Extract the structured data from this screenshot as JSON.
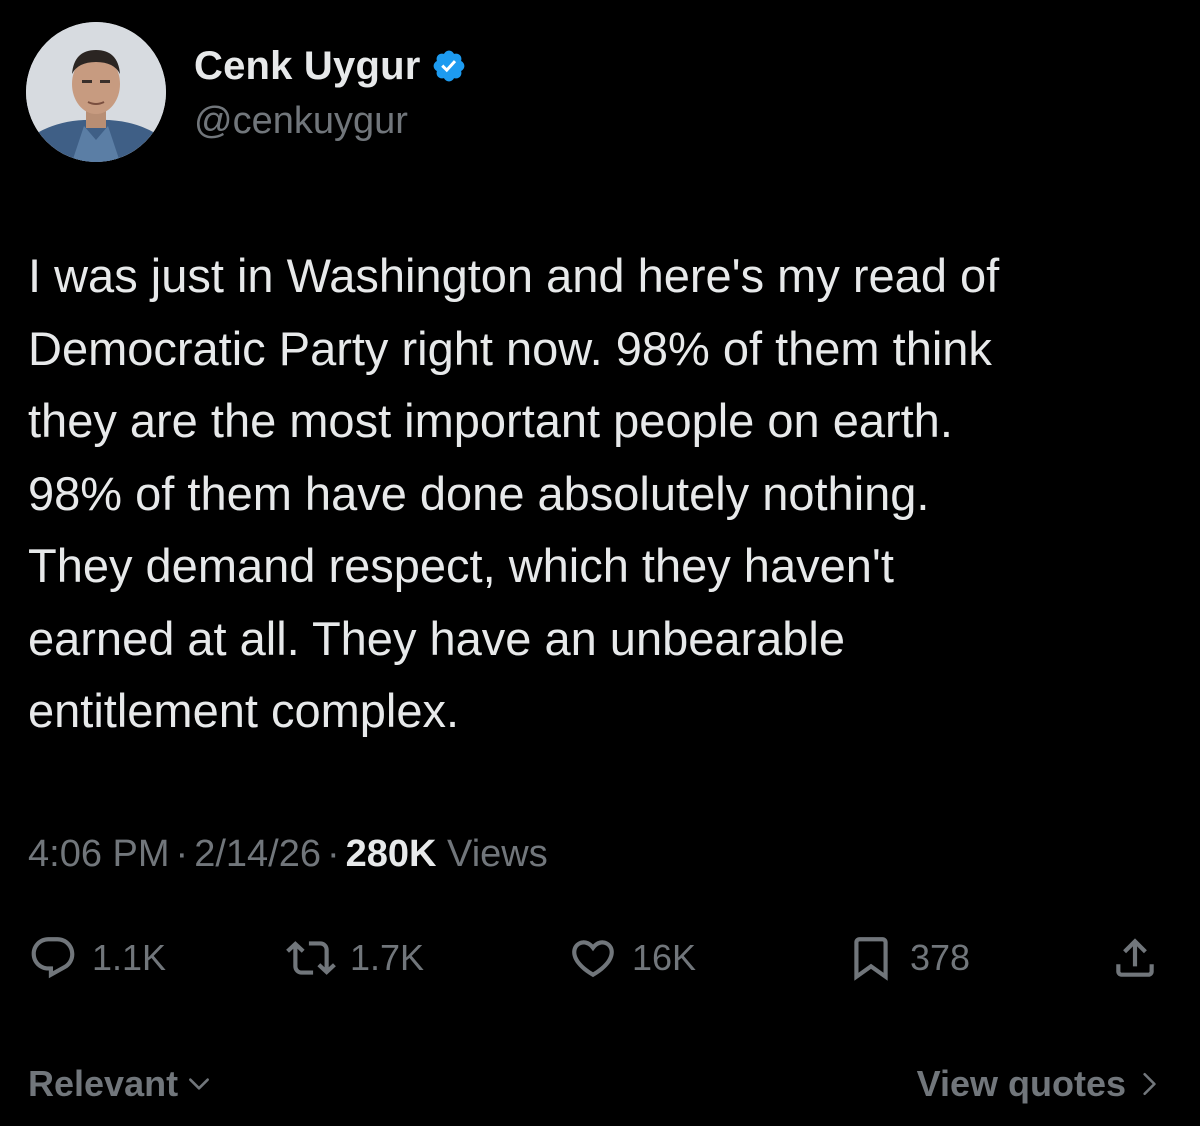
{
  "author": {
    "display_name": "Cenk Uygur",
    "handle": "@cenkuygur",
    "verified": true,
    "avatar_icon": "avatar-photo"
  },
  "tweet": {
    "text": "I was just in Washington and here's my read of\nDemocratic Party right now. 98% of them think\nthey are the most important people on earth.\n98% of them have done absolutely nothing.\nThey demand respect, which they haven't\nearned at all. They have an unbearable\nentitlement complex.",
    "time": "4:06 PM",
    "date": "2/14/26",
    "views_count": "280K",
    "views_label": "Views"
  },
  "actions": {
    "replies": "1.1K",
    "reposts": "1.7K",
    "likes": "16K",
    "bookmarks": "378"
  },
  "footer": {
    "sort_label": "Relevant",
    "quotes_label": "View quotes"
  },
  "colors": {
    "background": "#000000",
    "primary_text": "#e7e9ea",
    "secondary_text": "#71767b",
    "verified_blue": "#1d9bf0"
  }
}
